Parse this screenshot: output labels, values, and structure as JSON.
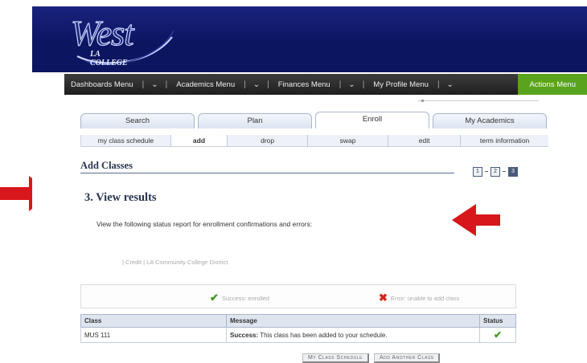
{
  "logo": {
    "word": "West",
    "sub": "LA COLLEGE"
  },
  "navbar": {
    "items": [
      {
        "label": "Dashboards Menu"
      },
      {
        "label": "Academics Menu"
      },
      {
        "label": "Finances Menu"
      },
      {
        "label": "My Profile Menu"
      }
    ],
    "actions_label": "Actions Menu"
  },
  "tabs": [
    "Search",
    "Plan",
    "Enroll",
    "My Academics"
  ],
  "active_tab": "Enroll",
  "subtabs": [
    "my class schedule",
    "add",
    "drop",
    "swap",
    "edit",
    "term information"
  ],
  "active_subtab": "add",
  "page_title": "Add Classes",
  "steps": [
    "1",
    "2",
    "3"
  ],
  "active_step": "3",
  "section_heading": "3.  View results",
  "instruction": "View the following status report for enrollment confirmations and errors:",
  "institution_line": "| Credit | LA Community College District",
  "legend": {
    "success": "Success: enrolled",
    "error": "Error: unable to add class"
  },
  "table": {
    "headers": [
      "Class",
      "Message",
      "Status"
    ],
    "rows": [
      {
        "class": "MUS 111",
        "message_bold": "Success:",
        "message": " This class has been added to your schedule.",
        "status": "success"
      }
    ]
  },
  "buttons": {
    "schedule": "My Class Schedule",
    "add_another": "Add Another Class"
  },
  "colors": {
    "header": "#0b1560",
    "actions": "#5aa31f",
    "success": "#3e9a1e",
    "error": "#d0261b",
    "arrow": "#d8171c"
  }
}
